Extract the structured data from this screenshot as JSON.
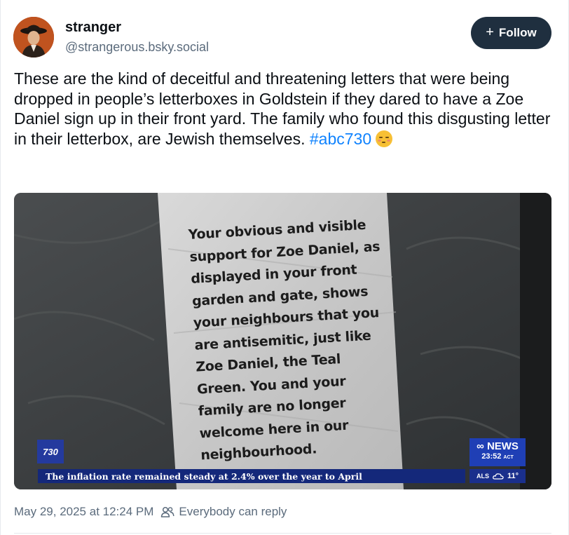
{
  "author": {
    "display_name": "stranger",
    "handle": "@strangerous.bsky.social"
  },
  "follow_button": {
    "label": "Follow",
    "icon": "plus-icon"
  },
  "post": {
    "text": "These are the kind of deceitful and threatening letters that were being dropped in people’s letterboxes in Goldstein if they dared to have a Zoe Daniel sign up in their front yard. The family who found this disgusting letter in their letterbox, are Jewish themselves. ",
    "hashtag": "#abc730",
    "emoji": "pensive-face-emoji"
  },
  "media": {
    "letter_text": "Your obvious and visible\nsupport for Zoe Daniel, as\ndisplayed in your front\ngarden and gate, shows\nyour neighbours that you\nare antisemitic, just like\nZoe Daniel, the Teal\nGreen. You and your\nfamily are no longer\nwelcome here in our\nneighbourhood.",
    "program_badge": "730",
    "ticker": "The inflation rate remained steady at 2.4% over the year to April",
    "news_brand": "NEWS",
    "news_time": "23:52",
    "news_time_zone": "ACT",
    "weather_location": "ALS",
    "weather_temp": "11°",
    "colors": {
      "badge": "#243a9e",
      "ticker": "#14287a",
      "news_logo": "#1f3fb5"
    }
  },
  "meta": {
    "timestamp": "May 29, 2025 at 12:24 PM",
    "reply_setting": "Everybody can reply"
  },
  "colors": {
    "follow_button_bg": "#1f2f3f",
    "hashtag": "#1083fe",
    "secondary_text": "#5b6b7c"
  }
}
